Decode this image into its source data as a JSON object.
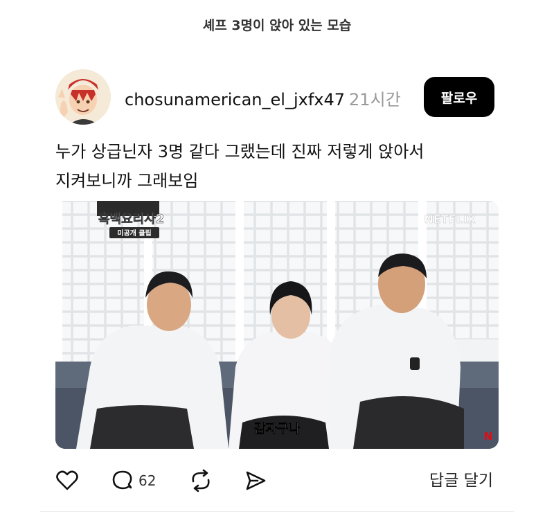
{
  "page": {
    "title": "셰프 3명이 앉아 있는 모습"
  },
  "post": {
    "username": "chosunamerican_el_jxfx47",
    "timestamp": "21시간",
    "follow_label": "팔로우",
    "text_lines": [
      "누가 상급닌자 3명 같다 그랬는데 진짜 저렇게 앉아서",
      "지켜보니까 그래보임"
    ],
    "media": {
      "show_title": "흑백요리사2",
      "show_subtitle": "미공개 클립",
      "brand": "NETFLIX",
      "caption": "감자구나",
      "brand_color": "#e50914"
    }
  },
  "actions": {
    "comment_count": "62",
    "reply_label": "답글 달기"
  }
}
